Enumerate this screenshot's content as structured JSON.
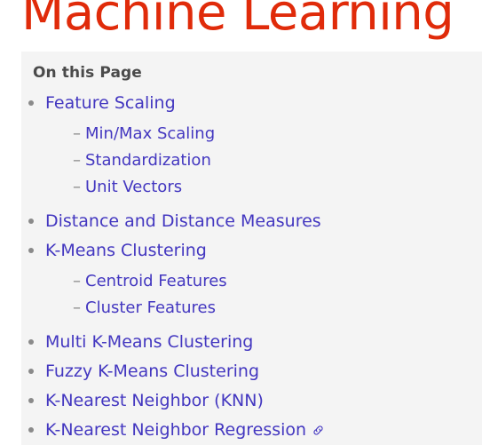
{
  "page": {
    "title": "Machine Learning",
    "title_color": "#e02b0a",
    "background_color": "#ffffff"
  },
  "toc": {
    "heading": "On this Page",
    "panel_color": "#f4f4f4",
    "link_color": "#4337c0",
    "bullet_color": "#8a8a8a",
    "heading_color": "#4a4a4a",
    "items": [
      {
        "label": "Feature Scaling",
        "children": [
          {
            "label": "Min/Max Scaling"
          },
          {
            "label": "Standardization"
          },
          {
            "label": "Unit Vectors"
          }
        ]
      },
      {
        "label": "Distance and Distance Measures",
        "children": []
      },
      {
        "label": "K-Means Clustering",
        "children": [
          {
            "label": "Centroid Features"
          },
          {
            "label": "Cluster Features"
          }
        ]
      },
      {
        "label": "Multi K-Means Clustering",
        "children": []
      },
      {
        "label": "Fuzzy K-Means Clustering",
        "children": []
      },
      {
        "label": "K-Nearest Neighbor (KNN)",
        "children": []
      },
      {
        "label": "K-Nearest Neighbor Regression",
        "children": [],
        "anchor_icon": "link-icon"
      }
    ]
  }
}
